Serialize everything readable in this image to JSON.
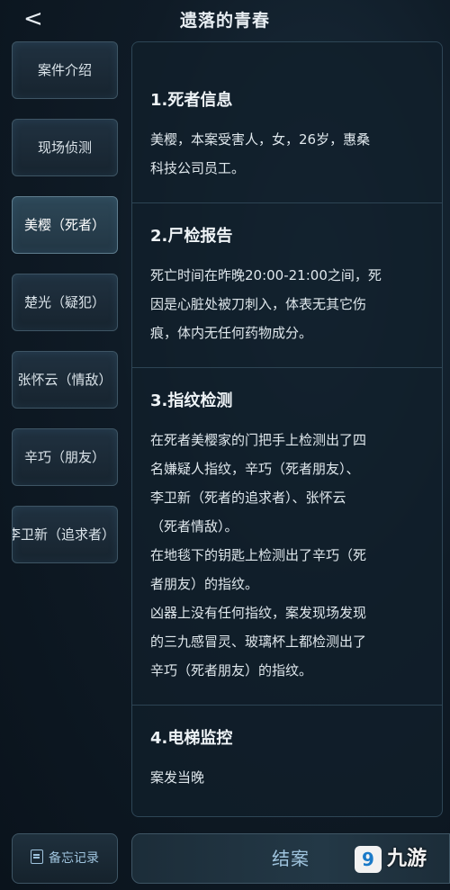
{
  "header": {
    "back_glyph": "<",
    "title": "遗落的青春"
  },
  "sidebar": {
    "items": [
      {
        "label": "案件介绍",
        "active": false
      },
      {
        "label": "现场侦测",
        "active": false
      },
      {
        "label": "美樱（死者）",
        "active": true
      },
      {
        "label": "楚光（疑犯）",
        "active": false
      },
      {
        "label": "张怀云（情敌）",
        "active": false
      },
      {
        "label": "辛巧（朋友）",
        "active": false
      },
      {
        "label": "李卫新（追求者）",
        "active": false
      }
    ]
  },
  "content": {
    "sections": [
      {
        "title": "1.死者信息",
        "lines": [
          "美樱，本案受害人，女，26岁，惠桑",
          "科技公司员工。"
        ]
      },
      {
        "title": "2.尸检报告",
        "lines": [
          "死亡时间在昨晚20:00-21:00之间，死",
          "因是心脏处被刀刺入，体表无其它伤",
          "痕，体内无任何药物成分。"
        ]
      },
      {
        "title": "3.指纹检测",
        "lines": [
          "在死者美樱家的门把手上检测出了四",
          "名嫌疑人指纹，辛巧（死者朋友）、",
          "李卫新（死者的追求者）、张怀云",
          "（死者情敌）。",
          "在地毯下的钥匙上检测出了辛巧（死",
          "者朋友）的指纹。",
          "凶器上没有任何指纹，案发现场发现",
          "的三九感冒灵、玻璃杯上都检测出了",
          "辛巧（死者朋友）的指纹。"
        ]
      },
      {
        "title": "4.电梯监控",
        "lines": [
          "案发当晚"
        ]
      }
    ]
  },
  "footer": {
    "memo_label": "备忘记录",
    "close_case_label": "结案"
  },
  "watermark": {
    "badge": "9",
    "text": "九游"
  },
  "colors": {
    "background": "#0f1b26",
    "accent": "#9fc4de",
    "panel_border": "#2e4656"
  }
}
